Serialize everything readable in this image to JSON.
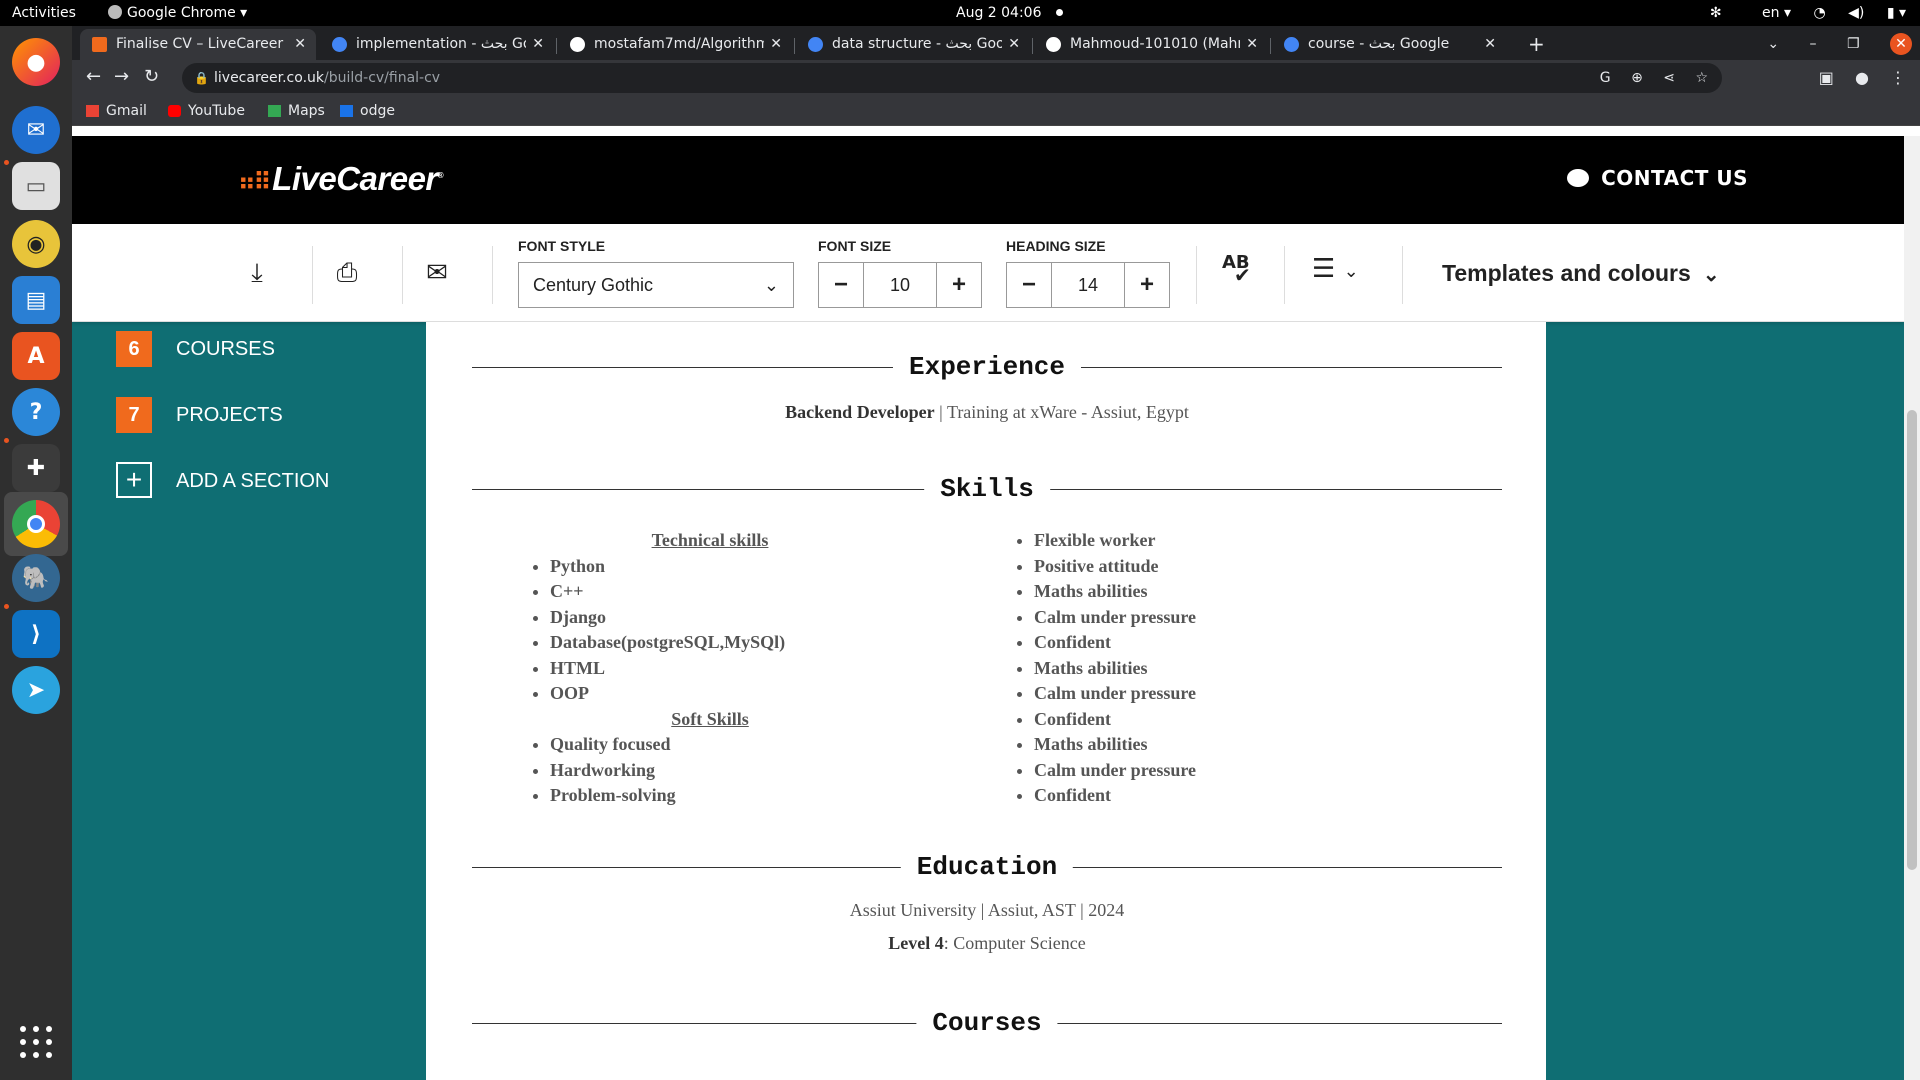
{
  "topbar": {
    "activities": "Activities",
    "app_name": "Google Chrome",
    "clock": "Aug 2  04:06",
    "language": "en"
  },
  "dock": {
    "apps": [
      "firefox",
      "thunderbird",
      "files",
      "rhythmbox",
      "writer",
      "app-center",
      "help",
      "slack",
      "chrome",
      "postgresql",
      "vscode",
      "telegram"
    ]
  },
  "tabs": [
    {
      "title": "Finalise CV – LiveCareer",
      "active": true
    },
    {
      "title": "implementation - بحث Go"
    },
    {
      "title": "mostafam7md/Algorithm"
    },
    {
      "title": "data structure - بحث Goog"
    },
    {
      "title": "Mahmoud-101010 (Mahm"
    },
    {
      "title": "course - بحث Google"
    }
  ],
  "address": {
    "domain": "livecareer.co.uk",
    "path": "/build-cv/final-cv"
  },
  "bookmarks": [
    "Gmail",
    "YouTube",
    "Maps",
    "odge"
  ],
  "site": {
    "logo_text": "LiveCareer",
    "contact_label": "CONTACT US"
  },
  "editbar": {
    "font_style_label": "FONT STYLE",
    "font_style_value": "Century Gothic",
    "font_size_label": "FONT SIZE",
    "font_size_value": "10",
    "heading_size_label": "HEADING SIZE",
    "heading_size_value": "14",
    "spellcheck_label": "AB",
    "templates_label": "Templates and colours"
  },
  "sidebar": {
    "items": [
      {
        "num": "6",
        "label": "COURSES"
      },
      {
        "num": "7",
        "label": "PROJECTS"
      },
      {
        "num": "+",
        "label": "ADD A SECTION"
      }
    ]
  },
  "resume": {
    "experience_title": "Experience",
    "experience_role": "Backend Developer",
    "experience_sep": "|",
    "experience_detail": "Training at xWare - Assiut, Egypt",
    "skills_title": "Skills",
    "technical_heading": "Technical skills",
    "technical_skills": [
      "Python",
      "C++",
      "Django",
      "Database(postgreSQL,MySQl)",
      "HTML",
      "OOP"
    ],
    "soft_heading": "Soft Skills",
    "soft_skills": [
      "Quality focused",
      "Hardworking",
      "Problem-solving"
    ],
    "other_skills": [
      "Flexible worker",
      "Positive attitude",
      "Maths abilities",
      "Calm under pressure",
      "Confident",
      "Maths abilities",
      "Calm under pressure",
      "Confident",
      "Maths abilities",
      "Calm under pressure",
      "Confident"
    ],
    "education_title": "Education",
    "education_line1": "Assiut University |  Assiut, AST  | 2024",
    "education_level_label": "Level 4",
    "education_level_value": ": Computer Science",
    "courses_title": "Courses"
  },
  "colors": {
    "brand_orange": "#f06a1d",
    "sidebar_teal": "#0f6e73",
    "header_black": "#000000"
  }
}
